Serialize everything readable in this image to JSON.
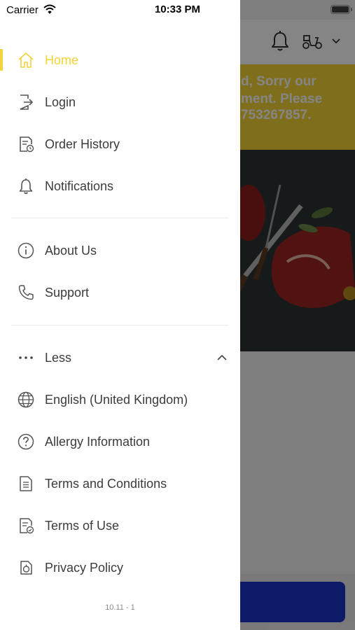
{
  "status_bar": {
    "carrier": "Carrier",
    "time": "10:33 PM"
  },
  "background_app": {
    "banner_lines": [
      "d, Sorry our",
      "ment. Please",
      "753267857."
    ],
    "banner_color": "#f4d334",
    "cta_color": "#1a34c9"
  },
  "drawer": {
    "accent_color": "#f0d43a",
    "primary_items": [
      {
        "label": "Home",
        "icon": "home-icon",
        "active": true
      },
      {
        "label": "Login",
        "icon": "login-icon"
      },
      {
        "label": "Order History",
        "icon": "order-history-icon"
      },
      {
        "label": "Notifications",
        "icon": "bell-icon"
      }
    ],
    "secondary_items": [
      {
        "label": "About Us",
        "icon": "info-icon"
      },
      {
        "label": "Support",
        "icon": "phone-icon"
      }
    ],
    "less_toggle": {
      "label": "Less",
      "icon": "more-dots-icon"
    },
    "more_items": [
      {
        "label": "English (United Kingdom)",
        "icon": "globe-icon"
      },
      {
        "label": "Allergy Information",
        "icon": "question-icon"
      },
      {
        "label": "Terms and Conditions",
        "icon": "document-icon"
      },
      {
        "label": "Terms of Use",
        "icon": "document-check-icon"
      },
      {
        "label": "Privacy Policy",
        "icon": "privacy-icon"
      }
    ],
    "version": "10.11 - 1"
  }
}
